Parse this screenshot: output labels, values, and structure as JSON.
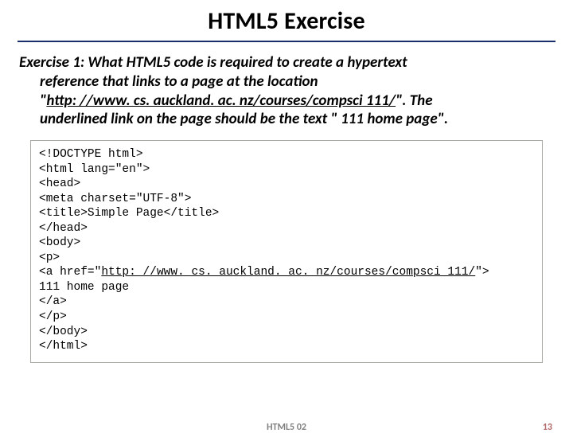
{
  "title": "HTML5 Exercise",
  "prompt": {
    "lead": "Exercise 1: What HTML5 code is required to create a hypertext",
    "line2": "reference that links to a page at the location",
    "line3_pre": "\"",
    "line3_url": "http: //www. cs. auckland. ac. nz/courses/compsci 111/",
    "line3_post": "\". The",
    "line4": "underlined link on the page should be the text \" 111 home page\"."
  },
  "code": {
    "l1": "<!DOCTYPE html>",
    "l2": "<html lang=\"en\">",
    "l3": "<head>",
    "l4": "<meta charset=\"UTF-8\">",
    "l5": "<title>Simple Page</title>",
    "l6": "</head>",
    "l7": "<body>",
    "l8": "<p>",
    "l9_pre": "<a href=\"",
    "l9_url": "http: //www. cs. auckland. ac. nz/courses/compsci 111/",
    "l9_post": "\">",
    "l10": "111 home page",
    "l11": "</a>",
    "l12": "</p>",
    "l13": "</body>",
    "l14": "</html>"
  },
  "footer": {
    "center": "HTML5 02",
    "page": "13"
  }
}
